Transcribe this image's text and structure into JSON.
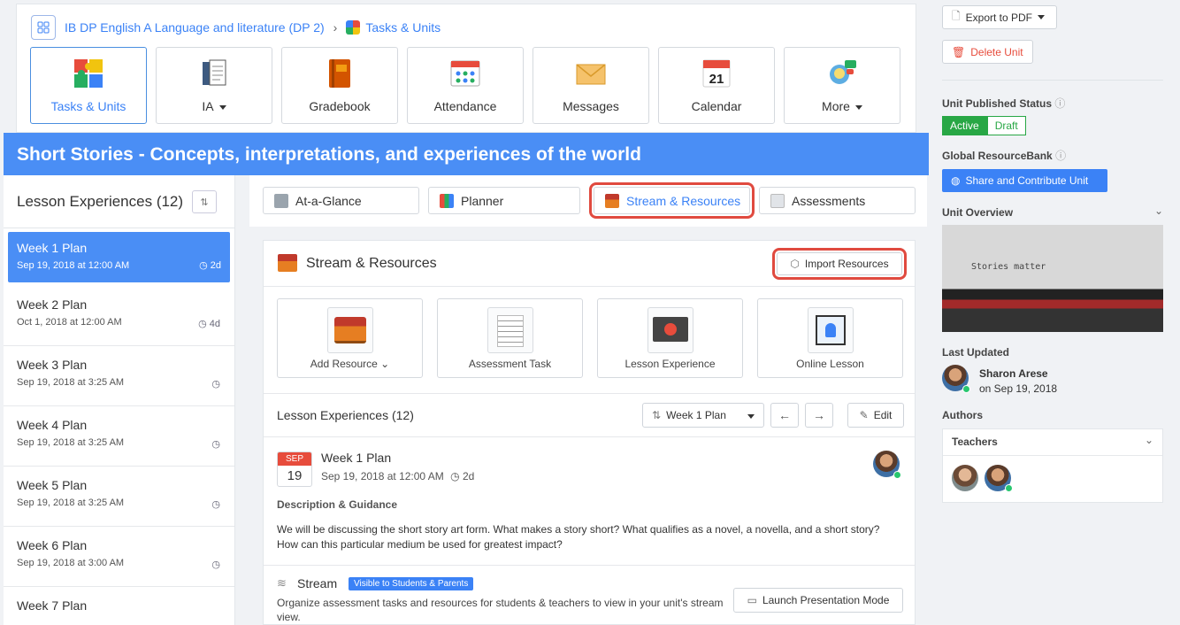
{
  "breadcrumb": {
    "course": "IB DP English A Language and literature (DP 2)",
    "current": "Tasks & Units"
  },
  "nav_tiles": [
    {
      "label": "Tasks & Units",
      "icon": "puzzle-icon"
    },
    {
      "label": "IA",
      "icon": "ia-book-icon"
    },
    {
      "label": "Gradebook",
      "icon": "gradebook-icon"
    },
    {
      "label": "Attendance",
      "icon": "attendance-icon"
    },
    {
      "label": "Messages",
      "icon": "envelope-icon"
    },
    {
      "label": "Calendar",
      "icon": "calendar-icon"
    },
    {
      "label": "More",
      "icon": "more-icon"
    }
  ],
  "calendar_icon_day": "21",
  "unit_title": "Short Stories - Concepts, interpretations, and experiences of the world",
  "lesson_panel": {
    "title": "Lesson Experiences (12)",
    "weeks": [
      {
        "title": "Week 1 Plan",
        "date": "Sep 19, 2018 at 12:00 AM",
        "duration": "2d"
      },
      {
        "title": "Week 2 Plan",
        "date": "Oct 1, 2018 at 12:00 AM",
        "duration": "4d"
      },
      {
        "title": "Week 3 Plan",
        "date": "Sep 19, 2018 at 3:25 AM",
        "duration": ""
      },
      {
        "title": "Week 4 Plan",
        "date": "Sep 19, 2018 at 3:25 AM",
        "duration": ""
      },
      {
        "title": "Week 5 Plan",
        "date": "Sep 19, 2018 at 3:25 AM",
        "duration": ""
      },
      {
        "title": "Week 6 Plan",
        "date": "Sep 19, 2018 at 3:00 AM",
        "duration": ""
      },
      {
        "title": "Week 7 Plan",
        "date": "",
        "duration": ""
      }
    ]
  },
  "tabs": [
    "At-a-Glance",
    "Planner",
    "Stream & Resources",
    "Assessments"
  ],
  "stream": {
    "title": "Stream & Resources",
    "import_label": "Import Resources",
    "actions": [
      "Add Resource",
      "Assessment Task",
      "Lesson Experience",
      "Online Lesson"
    ],
    "le_title": "Lesson Experiences (12)",
    "week_select": "Week 1 Plan",
    "edit_label": "Edit",
    "event": {
      "month": "SEP",
      "day": "19",
      "title": "Week 1 Plan",
      "date": "Sep 19, 2018 at 12:00 AM",
      "duration": "2d"
    },
    "desc_label": "Description & Guidance",
    "description": "We will be discussing the short story art form. What makes a story short? What qualifies as a novel, a novella, and a short story? How can this particular medium be used for greatest impact?",
    "stream_label": "Stream",
    "visible_badge": "Visible to Students & Parents",
    "stream_desc": "Organize assessment tasks and resources for students & teachers to view in your unit's stream view.",
    "launch_label": "Launch Presentation Mode"
  },
  "sidebar": {
    "export": "Export to PDF",
    "delete": "Delete Unit",
    "published_label": "Unit Published Status",
    "active": "Active",
    "draft": "Draft",
    "global_label": "Global ResourceBank",
    "share": "Share and Contribute Unit",
    "overview_label": "Unit Overview",
    "overview_text": "Stories matter",
    "last_updated_label": "Last Updated",
    "updater": "Sharon Arese",
    "updated_on": "on Sep 19, 2018",
    "authors_label": "Authors",
    "teachers_label": "Teachers"
  },
  "colors": {
    "primary": "#4a8ef5",
    "highlight": "#e04a3f",
    "danger": "#e74c3c",
    "success": "#28a745"
  }
}
